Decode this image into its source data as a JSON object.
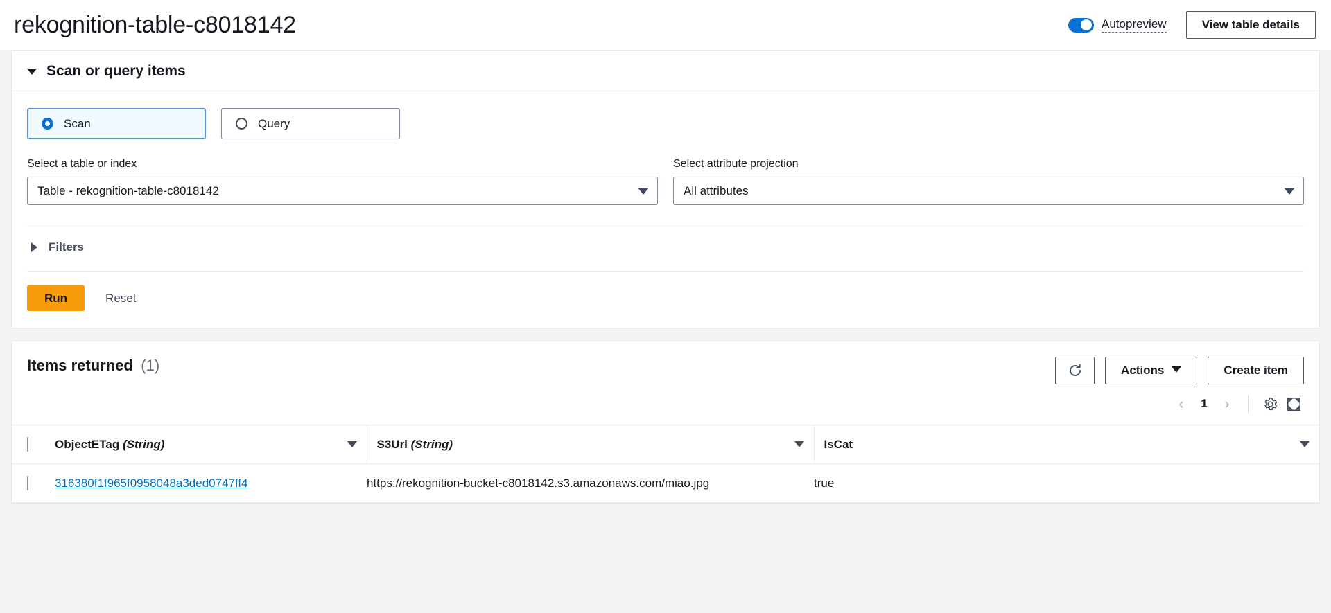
{
  "header": {
    "title": "rekognition-table-c8018142",
    "autopreview_label": "Autopreview",
    "autopreview_on": true,
    "view_table_details_label": "View table details"
  },
  "scan_panel": {
    "title": "Scan or query items",
    "expanded": true,
    "modes": [
      {
        "label": "Scan",
        "selected": true
      },
      {
        "label": "Query",
        "selected": false
      }
    ],
    "table_field": {
      "label": "Select a table or index",
      "value": "Table - rekognition-table-c8018142"
    },
    "projection_field": {
      "label": "Select attribute projection",
      "value": "All attributes"
    },
    "filters_label": "Filters",
    "filters_expanded": false,
    "run_label": "Run",
    "reset_label": "Reset"
  },
  "items_panel": {
    "title": "Items returned",
    "count": "(1)",
    "refresh_icon": "refresh-icon",
    "actions_label": "Actions",
    "create_item_label": "Create item",
    "pagination": {
      "prev": "‹",
      "page": "1",
      "next": "›"
    },
    "settings_icon": "gear-icon",
    "fullscreen_icon": "fullscreen-icon",
    "columns": [
      {
        "name": "ObjectETag",
        "type": "(String)",
        "sortable": true
      },
      {
        "name": "S3Url",
        "type": "(String)",
        "sortable": true
      },
      {
        "name": "IsCat",
        "type": "",
        "sortable": true
      }
    ],
    "rows": [
      {
        "object_etag": "316380f1f965f0958048a3ded0747ff4",
        "s3url": "https://rekognition-bucket-c8018142.s3.amazonaws.com/miao.jpg",
        "iscat": "true"
      }
    ]
  },
  "colors": {
    "accent_blue": "#0972d3",
    "run_orange": "#f89c0e",
    "link_blue": "#0073bb"
  }
}
